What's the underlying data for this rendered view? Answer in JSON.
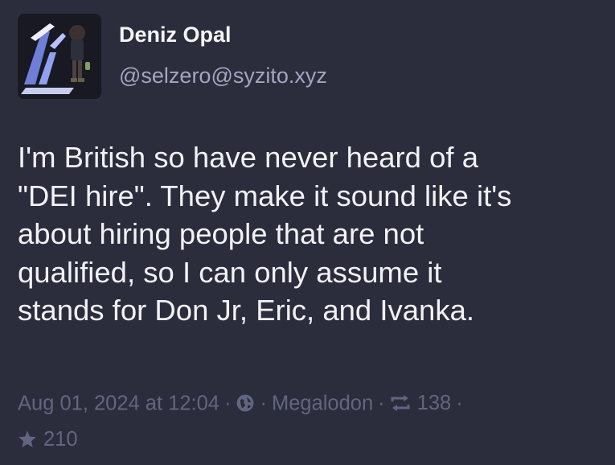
{
  "post": {
    "author": {
      "display_name": "Deniz Opal",
      "handle": "@selzero@syzito.xyz",
      "avatar_icon": "avatar-image"
    },
    "content_lines": [
      "I'm British so have never heard of a",
      "\"DEI hire\". They make it sound like it's",
      "about hiring people that are not",
      "qualified, so I can only assume it",
      "stands for Don Jr, Eric, and Ivanka."
    ],
    "meta": {
      "timestamp": "Aug 01, 2024 at 12:04",
      "separator": "·",
      "visibility_icon": "globe-icon",
      "application": "Megalodon",
      "reblog_icon": "reblog-icon",
      "reblog_count": "138",
      "favourite_icon": "star-icon",
      "favourite_count": "210"
    }
  },
  "colors": {
    "background": "#2b2d3c",
    "text": "#f2f2f5",
    "handle": "#a3a6c0",
    "meta": "#626580"
  }
}
